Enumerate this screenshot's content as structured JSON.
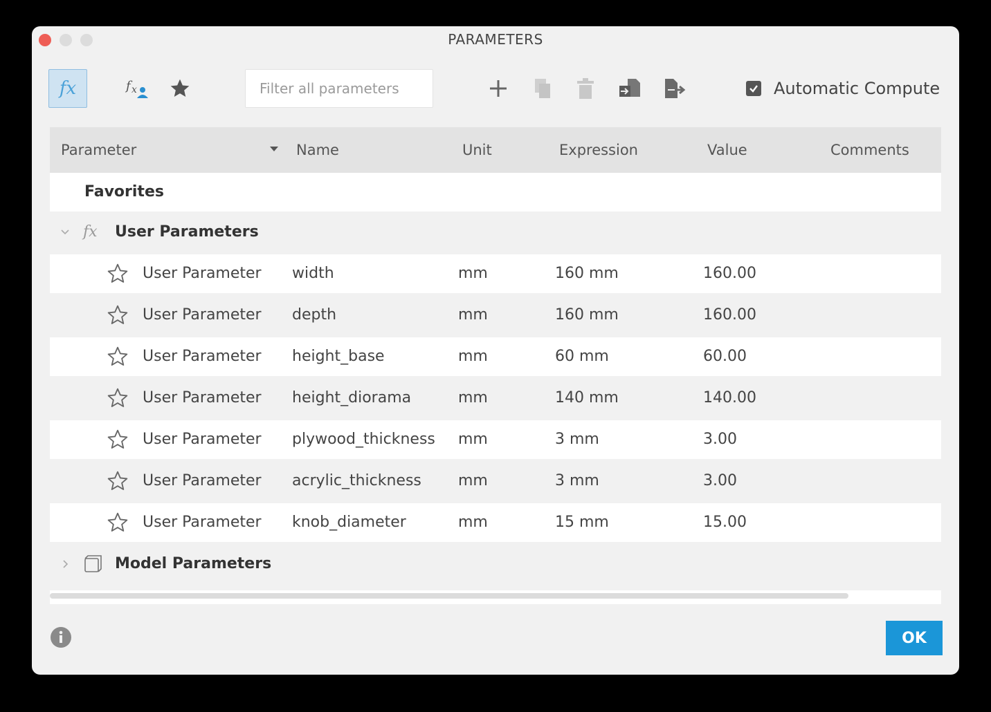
{
  "window": {
    "title": "PARAMETERS"
  },
  "toolbar": {
    "fx_glyph": "fx",
    "search_placeholder": "Filter all parameters",
    "auto_compute_label": "Automatic Compute",
    "auto_compute_checked": true,
    "icons": [
      "fx-icon",
      "fx-user-icon",
      "star-icon",
      "plus-icon",
      "copy-icon",
      "trash-icon",
      "import-icon",
      "export-icon"
    ]
  },
  "table": {
    "columns": [
      "Parameter",
      "Name",
      "Unit",
      "Expression",
      "Value",
      "Comments"
    ],
    "favorites_label": "Favorites",
    "user_group_label": "User Parameters",
    "user_group_glyph": "fx",
    "model_group_label": "Model Parameters",
    "rows": [
      {
        "parameter": "User Parameter",
        "name": "width",
        "unit": "mm",
        "expression": "160 mm",
        "value": "160.00",
        "comments": ""
      },
      {
        "parameter": "User Parameter",
        "name": "depth",
        "unit": "mm",
        "expression": "160 mm",
        "value": "160.00",
        "comments": ""
      },
      {
        "parameter": "User Parameter",
        "name": "height_base",
        "unit": "mm",
        "expression": "60 mm",
        "value": "60.00",
        "comments": ""
      },
      {
        "parameter": "User Parameter",
        "name": "height_diorama",
        "unit": "mm",
        "expression": "140 mm",
        "value": "140.00",
        "comments": ""
      },
      {
        "parameter": "User Parameter",
        "name": "plywood_thickness",
        "unit": "mm",
        "expression": "3 mm",
        "value": "3.00",
        "comments": ""
      },
      {
        "parameter": "User Parameter",
        "name": "acrylic_thickness",
        "unit": "mm",
        "expression": "3 mm",
        "value": "3.00",
        "comments": ""
      },
      {
        "parameter": "User Parameter",
        "name": "knob_diameter",
        "unit": "mm",
        "expression": "15 mm",
        "value": "15.00",
        "comments": ""
      }
    ]
  },
  "footer": {
    "ok_label": "OK"
  },
  "colors": {
    "accent": "#1b96d8",
    "close": "#ee5d55",
    "fx_blue": "#4aa1d8"
  }
}
